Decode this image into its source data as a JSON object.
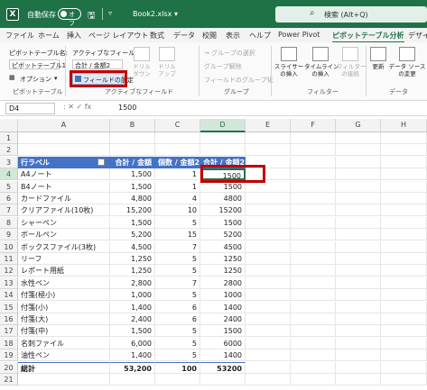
{
  "app": {
    "autosave_label": "自動保存",
    "autosave_state": "オフ",
    "filename": "Book2.xlsx",
    "filename_caret": "▾",
    "search_placeholder": "検索 (Alt+Q)",
    "save_glyph": "🖫",
    "qat_more": "▿"
  },
  "tabs": [
    "ファイル",
    "ホーム",
    "挿入",
    "ページ レイアウト",
    "数式",
    "データ",
    "校閲",
    "表示",
    "ヘルプ",
    "Power Pivot",
    "ピボットテーブル分析",
    "デザイン"
  ],
  "active_tab": "ピボットテーブル分析",
  "ribbon": {
    "pivot_name_label": "ピボットテーブル名:",
    "pivot_name_value": "ピボットテーブル1",
    "options_label": "オプション",
    "options_caret": "▾",
    "group_pivot": "ピボットテーブル",
    "active_field_label": "アクティブなフィールド:",
    "active_field_value": "合計 / 金額2",
    "field_settings": "フィールドの設定",
    "drill_down": "ドリル\nダウン",
    "drill_up": "ドリル\nアップ",
    "group_active_field": "アクティブなフィールド",
    "group_selection": "→ グループの選択",
    "ungroup": "グループ解除",
    "group_field": "フィールドのグループ化",
    "group_group": "グループ",
    "insert_slicer": "スライサー\nの挿入",
    "insert_timeline": "タイムライン\nの挿入",
    "filter_connections": "フィルター\nの接続",
    "group_filter": "フィルター",
    "refresh": "更新",
    "change_source": "データ ソース\nの変更",
    "group_data": "データ"
  },
  "formula_bar": {
    "name_box": "D4",
    "icons": ":  ✕  ✓  fx",
    "value": "1500"
  },
  "columns": [
    "A",
    "B",
    "C",
    "D",
    "E",
    "F",
    "G",
    "H"
  ],
  "active_column": "D",
  "active_row": "4",
  "rows": [
    "1",
    "2",
    "3",
    "4",
    "5",
    "6",
    "7",
    "8",
    "9",
    "10",
    "11",
    "12",
    "13",
    "14",
    "15",
    "16",
    "17",
    "18",
    "19",
    "20",
    "21"
  ],
  "pivot": {
    "headers": [
      "行ラベル",
      "合計 / 金額",
      "個数 / 金額2",
      "合計 / 金額2"
    ],
    "data": [
      [
        "A4ノート",
        "1,500",
        "1",
        "1500"
      ],
      [
        "B4ノート",
        "1,500",
        "1",
        "1500"
      ],
      [
        "カードファイル",
        "4,800",
        "4",
        "4800"
      ],
      [
        "クリアファイル(10枚)",
        "15,200",
        "10",
        "15200"
      ],
      [
        "シャーペン",
        "1,500",
        "5",
        "1500"
      ],
      [
        "ボールペン",
        "5,200",
        "15",
        "5200"
      ],
      [
        "ボックスファイル(3枚)",
        "4,500",
        "7",
        "4500"
      ],
      [
        "リーフ",
        "1,250",
        "5",
        "1250"
      ],
      [
        "レポート用紙",
        "1,250",
        "5",
        "1250"
      ],
      [
        "水性ペン",
        "2,800",
        "7",
        "2800"
      ],
      [
        "付箋(極小)",
        "1,000",
        "5",
        "1000"
      ],
      [
        "付箋(小)",
        "1,400",
        "6",
        "1400"
      ],
      [
        "付箋(大)",
        "2,400",
        "6",
        "2400"
      ],
      [
        "付箋(中)",
        "1,500",
        "5",
        "1500"
      ],
      [
        "名刺ファイル",
        "6,000",
        "5",
        "6000"
      ],
      [
        "油性ペン",
        "1,400",
        "5",
        "1400"
      ]
    ],
    "total": [
      "総計",
      "53,200",
      "100",
      "53200"
    ]
  }
}
